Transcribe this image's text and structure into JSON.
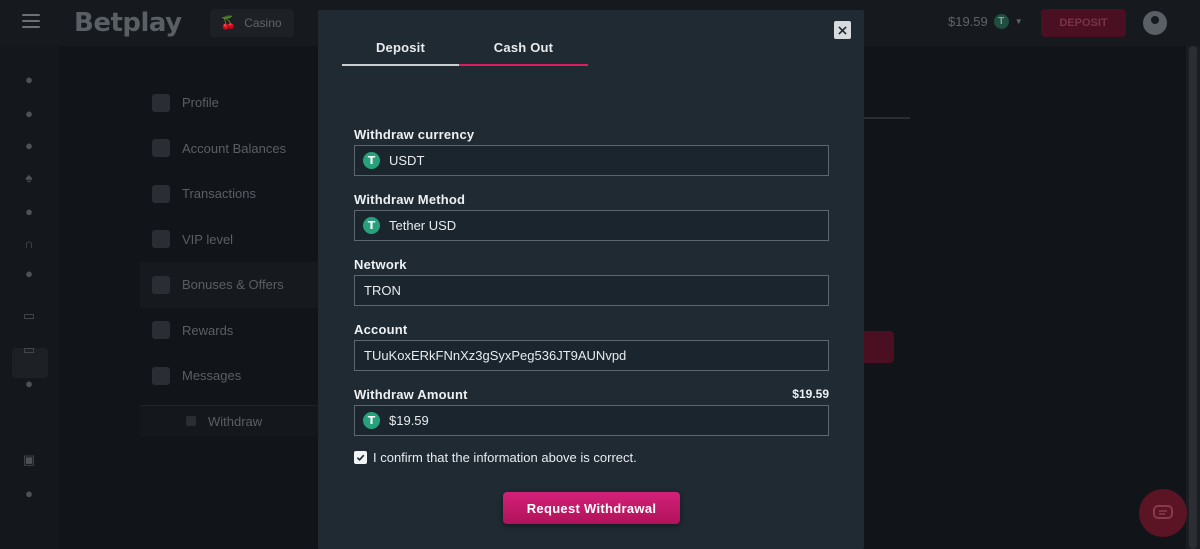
{
  "app": {
    "logo": "Betplay",
    "casino_label": "Casino",
    "balance": "$19.59",
    "deposit_button": "DEPOSIT"
  },
  "account_menu": {
    "items": [
      {
        "label": "Profile",
        "icon": "profile-icon"
      },
      {
        "label": "Account Balances",
        "icon": "balances-icon"
      },
      {
        "label": "Transactions",
        "icon": "transactions-icon"
      },
      {
        "label": "VIP level",
        "icon": "star-icon"
      },
      {
        "label": "Bonuses & Offers",
        "icon": "bonus-icon"
      },
      {
        "label": "Rewards",
        "icon": "rewards-icon"
      },
      {
        "label": "Messages",
        "icon": "messages-icon"
      }
    ],
    "sub_item": "Withdraw"
  },
  "modal": {
    "tabs": [
      {
        "label": "Deposit"
      },
      {
        "label": "Cash Out"
      }
    ],
    "active_tab": "Cash Out",
    "fields": {
      "currency": {
        "label": "Withdraw currency",
        "value": "USDT"
      },
      "method": {
        "label": "Withdraw Method",
        "value": "Tether USD"
      },
      "network": {
        "label": "Network",
        "value": "TRON"
      },
      "account": {
        "label": "Account",
        "value": "TUuKoxERkFNnXz3gSyxPeg536JT9AUNvpd"
      },
      "amount": {
        "label": "Withdraw Amount",
        "available": "$19.59",
        "value": "$19.59"
      }
    },
    "confirm_text": "I confirm that the information above is correct.",
    "confirm_checked": true,
    "submit_label": "Request Withdrawal"
  },
  "colors": {
    "accent": "#d91e63",
    "modal_bg": "#1f2a33",
    "tether": "#26a17b"
  }
}
